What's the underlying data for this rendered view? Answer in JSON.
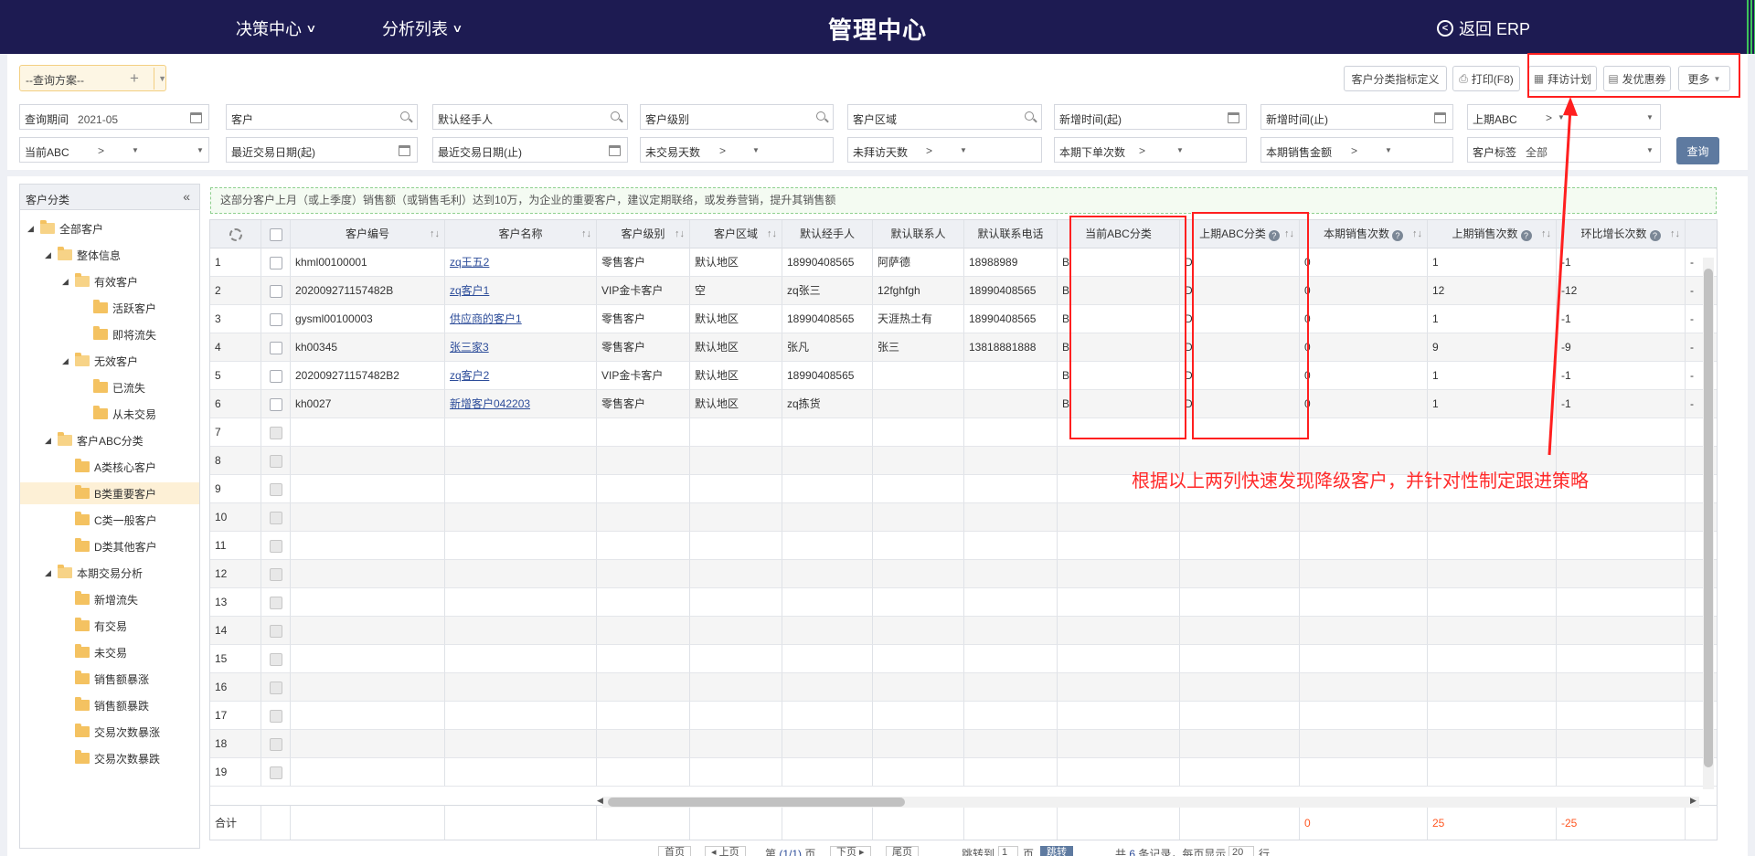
{
  "header": {
    "nav1": "决策中心",
    "nav2": "分析列表",
    "title": "管理中心",
    "back": "返回 ERP"
  },
  "toolbar": {
    "scheme": "--查询方案--",
    "btn_index": "客户分类指标定义",
    "btn_print": "打印(F8)",
    "btn_visit": "拜访计划",
    "btn_coupon": "发优惠券",
    "btn_more": "更多"
  },
  "filters": {
    "period_label": "查询期间",
    "period_value": "2021-05",
    "customer": "客户",
    "handler": "默认经手人",
    "level": "客户级别",
    "area": "客户区域",
    "new_from": "新增时间(起)",
    "new_to": "新增时间(止)",
    "prev_abc": "上期ABC",
    "cur_abc": "当前ABC",
    "last_trade_from": "最近交易日期(起)",
    "last_trade_to": "最近交易日期(止)",
    "no_trade_days": "未交易天数",
    "no_visit_days": "未拜访天数",
    "order_count": "本期下单次数",
    "sales_amount": "本期销售金额",
    "tag_label": "客户标签",
    "tag_value": "全部",
    "gt": ">",
    "query": "查询"
  },
  "sidebar": {
    "title": "客户分类",
    "items": [
      "全部客户",
      "整体信息",
      "有效客户",
      "活跃客户",
      "即将流失",
      "无效客户",
      "已流失",
      "从未交易",
      "客户ABC分类",
      "A类核心客户",
      "B类重要客户",
      "C类一般客户",
      "D类其他客户",
      "本期交易分析",
      "新增流失",
      "有交易",
      "未交易",
      "销售额暴涨",
      "销售额暴跌",
      "交易次数暴涨",
      "交易次数暴跌"
    ]
  },
  "notice": "这部分客户上月（或上季度）销售额（或销售毛利）达到10万，为企业的重要客户，建议定期联络，或发券营销，提升其销售额",
  "table": {
    "columns": [
      "客户编号",
      "客户名称",
      "客户级别",
      "客户区域",
      "默认经手人",
      "默认联系人",
      "默认联系电话",
      "当前ABC分类",
      "上期ABC分类",
      "本期销售次数",
      "上期销售次数",
      "环比增长次数"
    ],
    "rows": [
      [
        "khml00100001",
        "zq王五2",
        "零售客户",
        "默认地区",
        "18990408565",
        "阿萨德",
        "18988989",
        "B",
        "D",
        "0",
        "1",
        "-1"
      ],
      [
        "202009271157482B",
        "zq客户1",
        "VIP金卡客户",
        "空",
        "zq张三",
        "12fghfgh",
        "18990408565",
        "B",
        "D",
        "0",
        "12",
        "-12"
      ],
      [
        "gysml00100003",
        "供应商的客户1",
        "零售客户",
        "默认地区",
        "18990408565",
        "天涯热土有",
        "18990408565",
        "B",
        "D",
        "0",
        "1",
        "-1"
      ],
      [
        "kh00345",
        "张三家3",
        "零售客户",
        "默认地区",
        "张凡",
        "张三",
        "13818881888",
        "B",
        "D",
        "0",
        "9",
        "-9"
      ],
      [
        "202009271157482B2",
        "zq客户2",
        "VIP金卡客户",
        "默认地区",
        "18990408565",
        "",
        "",
        "B",
        "D",
        "0",
        "1",
        "-1"
      ],
      [
        "kh0027",
        "新增客户042203",
        "零售客户",
        "默认地区",
        "zq拣货",
        "",
        "",
        "B",
        "D",
        "0",
        "1",
        "-1"
      ]
    ],
    "empty_rows": [
      "7",
      "8",
      "9",
      "10",
      "11",
      "12",
      "13",
      "14",
      "15",
      "16",
      "17",
      "18",
      "19"
    ],
    "total_label": "合计",
    "total_cur": "0",
    "total_prev": "25",
    "total_growth": "-25",
    "trail": "-"
  },
  "pager": {
    "first": "首页",
    "prev": "上页",
    "page_prefix": "第",
    "page_info": "(1/1)",
    "page_suffix": "页",
    "next": "下页",
    "last": "尾页",
    "jump_label": "跳转到",
    "jump_value": "1",
    "jump_unit": "页",
    "jump_btn": "跳转",
    "total_prefix": "共",
    "total_count": "6",
    "total_suffix": "条记录，每页显示",
    "per_page": "20",
    "per_page_unit": "行"
  },
  "annotation": "根据以上两列快速发现降级客户，并针对性制定跟进策略",
  "colors": {
    "header_bg": "#1d1b52",
    "annotation_red": "#ff1f1f",
    "link": "#2d4d9a",
    "query_btn": "#5e7aa0"
  }
}
